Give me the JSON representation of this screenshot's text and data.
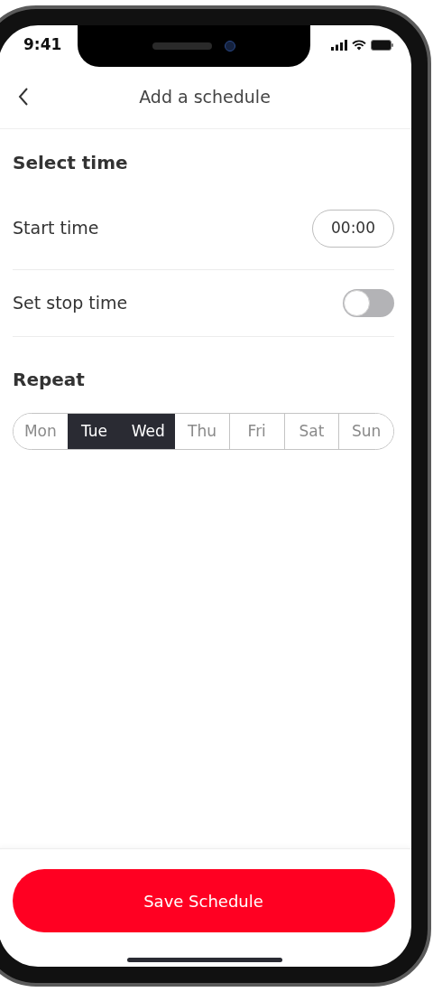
{
  "status_bar": {
    "time": "9:41"
  },
  "header": {
    "title": "Add a schedule"
  },
  "select_time": {
    "title": "Select time",
    "rows": [
      {
        "kind": "time",
        "label": "Start time",
        "value": "00:00"
      },
      {
        "kind": "toggle",
        "label": "Set stop time",
        "on": false
      }
    ]
  },
  "repeat": {
    "title": "Repeat",
    "days": [
      {
        "label": "Mon",
        "selected": false
      },
      {
        "label": "Tue",
        "selected": true
      },
      {
        "label": "Wed",
        "selected": true
      },
      {
        "label": "Thu",
        "selected": false
      },
      {
        "label": "Fri",
        "selected": false
      },
      {
        "label": "Sat",
        "selected": false
      },
      {
        "label": "Sun",
        "selected": false
      }
    ]
  },
  "primary_button": {
    "label": "Save Schedule"
  }
}
